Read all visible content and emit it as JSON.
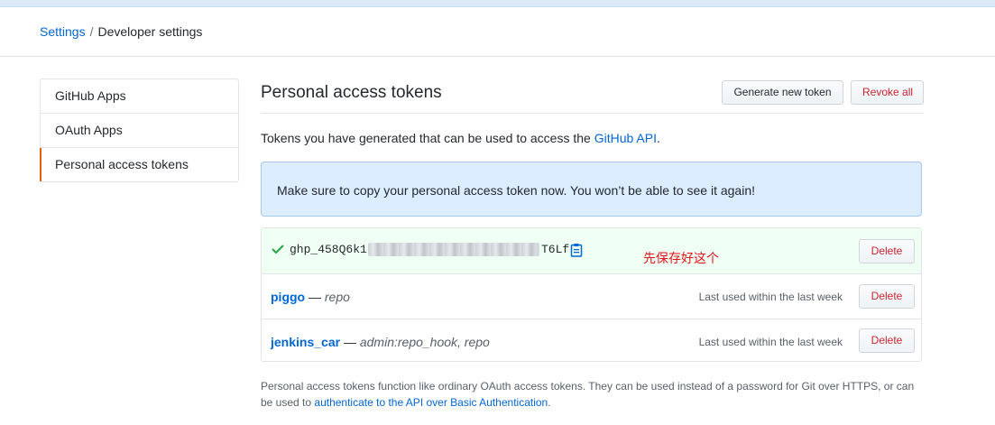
{
  "breadcrumb": {
    "root": "Settings",
    "separator": "/",
    "current": "Developer settings"
  },
  "sidebar": {
    "items": [
      {
        "label": "GitHub Apps"
      },
      {
        "label": "OAuth Apps"
      },
      {
        "label": "Personal access tokens",
        "selected": true
      }
    ]
  },
  "main": {
    "title": "Personal access tokens",
    "generate_label": "Generate new token",
    "revoke_label": "Revoke all",
    "intro_prefix": "Tokens you have generated that can be used to access the ",
    "intro_link": "GitHub API",
    "intro_suffix": ".",
    "flash_message": "Make sure to copy your personal access token now. You won’t be able to see it again!"
  },
  "tokens": {
    "new_token": {
      "prefix": "ghp_458Q6k1",
      "suffix": "T6Lf",
      "annotation": "先保存好这个",
      "delete_label": "Delete",
      "icon": "check-icon",
      "copy_icon": "clipboard-icon"
    },
    "rows": [
      {
        "name": "piggo",
        "dash": " — ",
        "scopes": "repo",
        "last_used": "Last used within the last week",
        "delete_label": "Delete"
      },
      {
        "name": "jenkins_car",
        "dash": " — ",
        "scopes": "admin:repo_hook, repo",
        "last_used": "Last used within the last week",
        "delete_label": "Delete"
      }
    ]
  },
  "footer": {
    "text": "Personal access tokens function like ordinary OAuth access tokens. They can be used instead of a password for Git over HTTPS, or can be used to ",
    "link": "authenticate to the API over Basic Authentication",
    "suffix": "."
  },
  "colors": {
    "link": "#0366d6",
    "danger": "#cb2431",
    "success_bg": "#f0fff4",
    "success_icon": "#28a745",
    "flash_bg": "#dbedff",
    "annotation": "#e3151b",
    "selected_marker": "#e36209"
  }
}
